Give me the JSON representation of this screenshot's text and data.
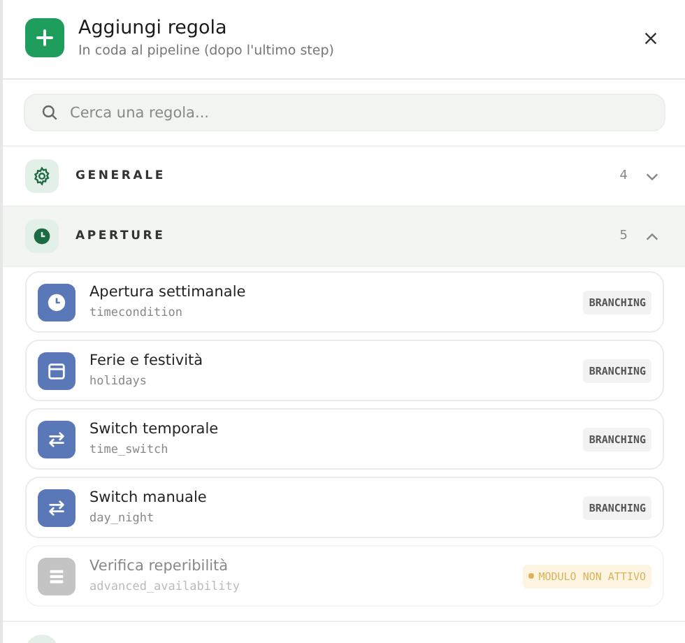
{
  "header": {
    "title": "Aggiungi regola",
    "subtitle": "In coda al pipeline (dopo l'ultimo step)"
  },
  "search": {
    "placeholder": "Cerca una regola..."
  },
  "categories": [
    {
      "kind": "gear",
      "label": "GENERALE",
      "count": "4",
      "expanded": false
    },
    {
      "kind": "clock",
      "label": "APERTURE",
      "count": "5",
      "expanded": true,
      "items": [
        {
          "kind": "clock",
          "name": "Apertura settimanale",
          "code": "timecondition",
          "badge": "BRANCHING",
          "disabled": false
        },
        {
          "kind": "calendar",
          "name": "Ferie e festività",
          "code": "holidays",
          "badge": "BRANCHING",
          "disabled": false
        },
        {
          "kind": "swap",
          "name": "Switch temporale",
          "code": "time_switch",
          "badge": "BRANCHING",
          "disabled": false
        },
        {
          "kind": "swap",
          "name": "Switch manuale",
          "code": "day_night",
          "badge": "BRANCHING",
          "disabled": false
        },
        {
          "kind": "list",
          "name": "Verifica reperibilità",
          "code": "advanced_availability",
          "badge": "MODULO NON ATTIVO",
          "disabled": true
        }
      ]
    }
  ]
}
